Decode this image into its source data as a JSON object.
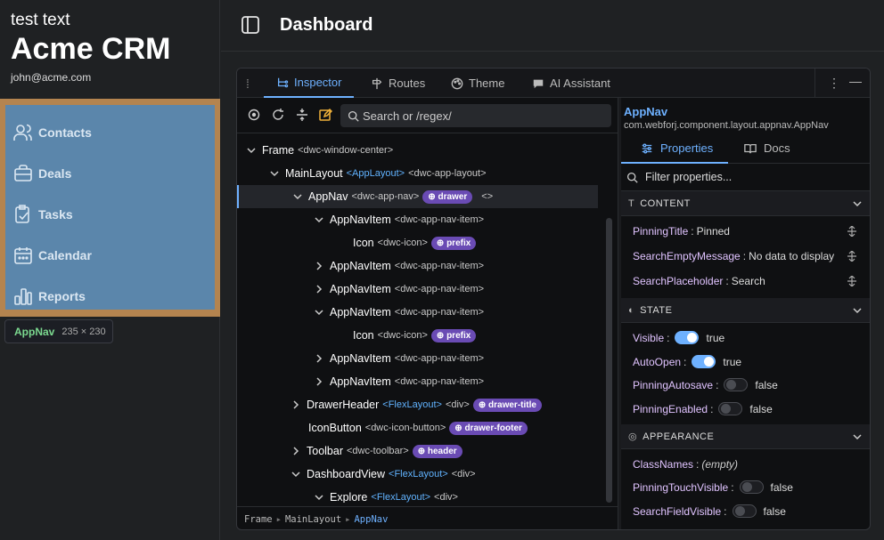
{
  "sidebar": {
    "top_text": "test text",
    "app_name": "Acme CRM",
    "email": "john@acme.com",
    "nav": [
      {
        "label": "Contacts",
        "icon": "users-icon"
      },
      {
        "label": "Deals",
        "icon": "briefcase-icon"
      },
      {
        "label": "Tasks",
        "icon": "clipboard-icon"
      },
      {
        "label": "Calendar",
        "icon": "calendar-icon"
      },
      {
        "label": "Reports",
        "icon": "chart-icon"
      }
    ],
    "tooltip": {
      "name": "AppNav",
      "size": "235 × 230"
    },
    "highlight_color": "#b4844f",
    "nav_bg_color": "#5b86ab"
  },
  "header": {
    "title": "Dashboard"
  },
  "devtools": {
    "tabs": [
      {
        "label": "Inspector",
        "active": true
      },
      {
        "label": "Routes"
      },
      {
        "label": "Theme"
      },
      {
        "label": "AI Assistant"
      }
    ],
    "search_placeholder": "Search or /regex/",
    "tree": [
      {
        "name": "Frame",
        "tag": "<dwc-window-center>"
      },
      {
        "name": "MainLayout",
        "alt": "<AppLayout>",
        "tag": "<dwc-app-layout>"
      },
      {
        "name": "AppNav",
        "tag": "<dwc-app-nav>",
        "badge": "drawer",
        "extra": "<>"
      },
      {
        "name": "AppNavItem",
        "tag": "<dwc-app-nav-item>"
      },
      {
        "name": "Icon",
        "tag": "<dwc-icon>",
        "badge": "prefix"
      },
      {
        "name": "AppNavItem",
        "tag": "<dwc-app-nav-item>"
      },
      {
        "name": "AppNavItem",
        "tag": "<dwc-app-nav-item>"
      },
      {
        "name": "AppNavItem",
        "tag": "<dwc-app-nav-item>"
      },
      {
        "name": "Icon",
        "tag": "<dwc-icon>",
        "badge": "prefix"
      },
      {
        "name": "AppNavItem",
        "tag": "<dwc-app-nav-item>"
      },
      {
        "name": "AppNavItem",
        "tag": "<dwc-app-nav-item>"
      },
      {
        "name": "DrawerHeader",
        "alt": "<FlexLayout>",
        "tag": "<div>",
        "badge": "drawer-title"
      },
      {
        "name": "IconButton",
        "tag": "<dwc-icon-button>",
        "badge": "drawer-footer"
      },
      {
        "name": "Toolbar",
        "tag": "<dwc-toolbar>",
        "badge": "header"
      },
      {
        "name": "DashboardView",
        "alt": "<FlexLayout>",
        "tag": "<div>"
      },
      {
        "name": "Explore",
        "alt": "<FlexLayout>",
        "tag": "<div>"
      }
    ],
    "breadcrumb": [
      "Frame",
      "MainLayout",
      "AppNav"
    ],
    "right": {
      "component": "AppNav",
      "class_name": "com.webforj.component.layout.appnav.AppNav",
      "tabs": [
        {
          "label": "Properties",
          "active": true
        },
        {
          "label": "Docs"
        }
      ],
      "filter_placeholder": "Filter properties...",
      "sections": {
        "content": {
          "title": "CONTENT",
          "props": [
            {
              "key": "PinningTitle",
              "value": "Pinned"
            },
            {
              "key": "SearchEmptyMessage",
              "value": "No data to display"
            },
            {
              "key": "SearchPlaceholder",
              "value": "Search"
            }
          ]
        },
        "state": {
          "title": "STATE",
          "props": [
            {
              "key": "Visible",
              "value": "true",
              "on": true
            },
            {
              "key": "AutoOpen",
              "value": "true",
              "on": true
            },
            {
              "key": "PinningAutosave",
              "value": "false",
              "on": false
            },
            {
              "key": "PinningEnabled",
              "value": "false",
              "on": false
            }
          ]
        },
        "appearance": {
          "title": "APPEARANCE",
          "props": [
            {
              "key": "ClassNames",
              "value": "(empty)"
            },
            {
              "key": "PinningTouchVisible",
              "value": "false",
              "on": false
            },
            {
              "key": "SearchFieldVisible",
              "value": "false",
              "on": false
            }
          ]
        }
      }
    }
  }
}
